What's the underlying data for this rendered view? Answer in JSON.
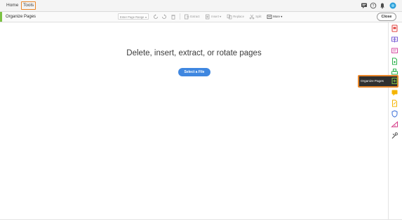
{
  "menubar": {
    "home_label": "Home",
    "tools_label": "Tools",
    "icons": [
      "comment-icon",
      "help-icon",
      "bell-icon",
      "account-icon"
    ]
  },
  "toolbar": {
    "title": "Organize Pages",
    "page_range_placeholder": "Enter Page Range",
    "extract_label": "Extract",
    "insert_label": "Insert",
    "replace_label": "Replace",
    "split_label": "Split",
    "more_label": "More",
    "close_label": "Close"
  },
  "main": {
    "heading": "Delete, insert, extract, or rotate pages",
    "select_file_label": "Select a File"
  },
  "right_panel": {
    "highlighted_tool_label": "Organize Pages",
    "tools": [
      {
        "icon": "export-pdf-icon",
        "color": "#e0413d"
      },
      {
        "icon": "edit-pdf-icon",
        "color": "#7a5fd6"
      },
      {
        "icon": "comment-tool-icon",
        "color": "#d54fa4"
      },
      {
        "icon": "create-pdf-icon",
        "color": "#2bb24c"
      },
      {
        "icon": "combine-files-icon",
        "color": "#2bb24c"
      },
      {
        "icon": "organize-pages-icon",
        "color": "#7cc244"
      },
      {
        "icon": "comment-icon",
        "color": "#f4b400"
      },
      {
        "icon": "fill-sign-icon",
        "color": "#f4b400"
      },
      {
        "icon": "protect-icon",
        "color": "#3b6fd8"
      },
      {
        "icon": "measure-icon",
        "color": "#d53a87"
      },
      {
        "icon": "more-tools-icon",
        "color": "#4a4a4a"
      }
    ]
  }
}
